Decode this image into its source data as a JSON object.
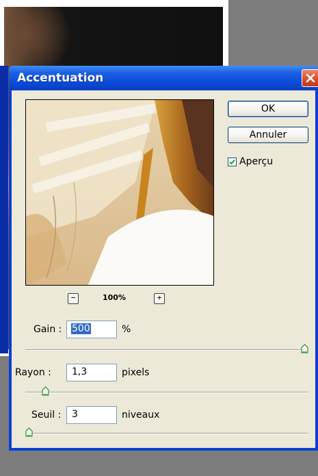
{
  "dialog": {
    "title": "Accentuation",
    "ok_label": "OK",
    "cancel_label": "Annuler",
    "preview_checkbox": {
      "label": "Aperçu",
      "checked": true
    },
    "zoom": {
      "value": "100%",
      "minus_glyph": "−",
      "plus_glyph": "+"
    },
    "amount": {
      "label": "Gain :",
      "value": "500",
      "unit": "%",
      "slider_fraction": 1.0
    },
    "radius": {
      "label": "Rayon :",
      "value": "1,3",
      "unit": "pixels",
      "slider_fraction": 0.06
    },
    "threshold": {
      "label": "Seuil :",
      "value": "3",
      "unit": "niveaux",
      "slider_fraction": 0.0
    }
  },
  "colors": {
    "title_bar": "#0a4ad8",
    "dialog_face": "#ece9d8",
    "close_button": "#d84a28",
    "selection": "#316ac5"
  },
  "icons": [
    "close-icon",
    "checkmark-icon",
    "zoom-out-icon",
    "zoom-in-icon",
    "slider-thumb-icon"
  ]
}
